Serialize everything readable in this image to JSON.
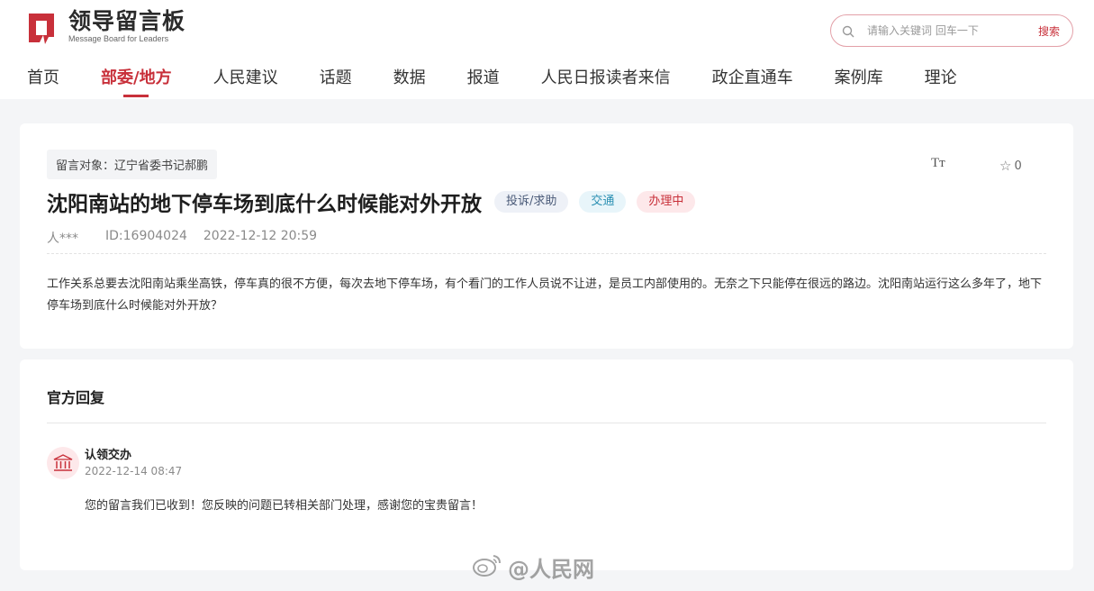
{
  "brand": {
    "title": "领导留言板",
    "subtitle": "Message Board for Leaders",
    "accent_color": "#c8303a"
  },
  "search": {
    "placeholder": "请输入关键词 回车一下",
    "button_label": "搜索",
    "icon": "search-icon"
  },
  "nav": {
    "items": [
      {
        "label": "首页",
        "active": false
      },
      {
        "label": "部委/地方",
        "active": true
      },
      {
        "label": "人民建议",
        "active": false
      },
      {
        "label": "话题",
        "active": false
      },
      {
        "label": "数据",
        "active": false
      },
      {
        "label": "报道",
        "active": false
      },
      {
        "label": "人民日报读者来信",
        "active": false
      },
      {
        "label": "政企直通车",
        "active": false
      },
      {
        "label": "案例库",
        "active": false
      },
      {
        "label": "理论",
        "active": false
      }
    ]
  },
  "message": {
    "target": "留言对象：辽宁省委书记郝鹏",
    "font_toggle": "Tт",
    "favorite_count": "0",
    "title": "沈阳南站的地下停车场到底什么时候能对外开放",
    "tags": {
      "category": "投诉/求助",
      "field": "交通",
      "status": "办理中"
    },
    "author": "人***",
    "id": "ID:16904024",
    "time": "2022-12-12 20:59",
    "content": "工作关系总要去沈阳南站乘坐高铁，停车真的很不方便，每次去地下停车场，有个看门的工作人员说不让进，是员工内部使用的。无奈之下只能停在很远的路边。沈阳南站运行这么多年了，地下停车场到底什么时候能对外开放？"
  },
  "reply": {
    "heading": "官方回复",
    "org": "认领交办",
    "date": "2022-12-14 08:47",
    "text": "您的留言我们已收到！您反映的问题已转相关部门处理，感谢您的宝贵留言！",
    "avatar_icon": "government-building-icon"
  },
  "watermark": {
    "text": "@人民网",
    "icon": "weibo-icon"
  }
}
